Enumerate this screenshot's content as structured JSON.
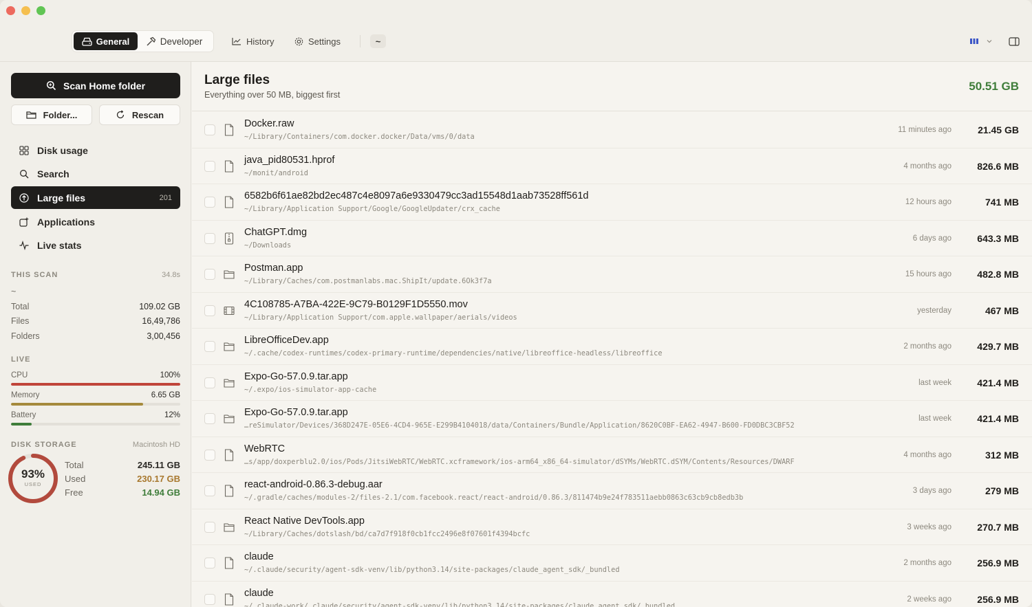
{
  "toolbar": {
    "tabs": [
      {
        "label": "General",
        "active": true,
        "icon": "drive-icon"
      },
      {
        "label": "Developer",
        "active": false,
        "icon": "hammer-icon"
      }
    ],
    "history_label": "History",
    "settings_label": "Settings",
    "tilde_label": "~"
  },
  "sidebar": {
    "scan_button": "Scan Home folder",
    "folder_button": "Folder...",
    "rescan_button": "Rescan",
    "nav": [
      {
        "label": "Disk usage",
        "icon": "grid-icon",
        "badge": ""
      },
      {
        "label": "Search",
        "icon": "search-icon",
        "badge": ""
      },
      {
        "label": "Large files",
        "icon": "arrow-up-circle-icon",
        "badge": "201",
        "active": true
      },
      {
        "label": "Applications",
        "icon": "app-add-icon",
        "badge": ""
      },
      {
        "label": "Live stats",
        "icon": "pulse-icon",
        "badge": ""
      }
    ],
    "this_scan": {
      "heading": "THIS SCAN",
      "duration": "34.8s",
      "path": "~",
      "stats": [
        {
          "label": "Total",
          "value": "109.02 GB"
        },
        {
          "label": "Files",
          "value": "16,49,786"
        },
        {
          "label": "Folders",
          "value": "3,00,456"
        }
      ]
    },
    "live": {
      "heading": "LIVE",
      "cpu": {
        "label": "CPU",
        "value": "100%",
        "fraction": 1.0,
        "color": "#c0453a"
      },
      "memory": {
        "label": "Memory",
        "value": "6.65 GB",
        "fraction": 0.78,
        "color": "#a58a3c"
      },
      "battery": {
        "label": "Battery",
        "value": "12%",
        "fraction": 0.12,
        "color": "#3f7d3a"
      }
    },
    "disk": {
      "heading": "DISK STORAGE",
      "volume": "Macintosh HD",
      "percent": "93%",
      "used_caption": "USED",
      "fraction_used": 0.93,
      "ring_color": "#b24a3d",
      "total_label": "Total",
      "total": "245.11 GB",
      "used_label": "Used",
      "used": "230.17 GB",
      "used_color": "#a8782e",
      "free_label": "Free",
      "free": "14.94 GB",
      "free_color": "#3f7d3a"
    }
  },
  "main": {
    "title": "Large files",
    "subtitle": "Everything over 50 MB, biggest first",
    "total": "50.51 GB",
    "rows": [
      {
        "name": "Docker.raw",
        "path": "~/Library/Containers/com.docker.docker/Data/vms/0/data",
        "when": "11 minutes ago",
        "size": "21.45 GB",
        "icon": "file-icon"
      },
      {
        "name": "java_pid80531.hprof",
        "path": "~/monit/android",
        "when": "4 months ago",
        "size": "826.6 MB",
        "icon": "file-icon"
      },
      {
        "name": "6582b6f61ae82bd2ec487c4e8097a6e9330479cc3ad15548d1aab73528ff561d",
        "path": "~/Library/Application Support/Google/GoogleUpdater/crx_cache",
        "when": "12 hours ago",
        "size": "741 MB",
        "icon": "file-icon"
      },
      {
        "name": "ChatGPT.dmg",
        "path": "~/Downloads",
        "when": "6 days ago",
        "size": "643.3 MB",
        "icon": "archive-icon"
      },
      {
        "name": "Postman.app",
        "path": "~/Library/Caches/com.postmanlabs.mac.ShipIt/update.6Ok3f7a",
        "when": "15 hours ago",
        "size": "482.8 MB",
        "icon": "folder-icon"
      },
      {
        "name": "4C108785-A7BA-422E-9C79-B0129F1D5550.mov",
        "path": "~/Library/Application Support/com.apple.wallpaper/aerials/videos",
        "when": "yesterday",
        "size": "467 MB",
        "icon": "film-icon"
      },
      {
        "name": "LibreOfficeDev.app",
        "path": "~/.cache/codex-runtimes/codex-primary-runtime/dependencies/native/libreoffice-headless/libreoffice",
        "when": "2 months ago",
        "size": "429.7 MB",
        "icon": "folder-icon"
      },
      {
        "name": "Expo-Go-57.0.9.tar.app",
        "path": "~/.expo/ios-simulator-app-cache",
        "when": "last week",
        "size": "421.4 MB",
        "icon": "folder-icon"
      },
      {
        "name": "Expo-Go-57.0.9.tar.app",
        "path": "…reSimulator/Devices/368D247E-05E6-4CD4-965E-E299B4104018/data/Containers/Bundle/Application/8620C0BF-EA62-4947-B600-FD0DBC3CBF52",
        "when": "last week",
        "size": "421.4 MB",
        "icon": "folder-icon"
      },
      {
        "name": "WebRTC",
        "path": "…s/app/doxperblu2.0/ios/Pods/JitsiWebRTC/WebRTC.xcframework/ios-arm64_x86_64-simulator/dSYMs/WebRTC.dSYM/Contents/Resources/DWARF",
        "when": "4 months ago",
        "size": "312 MB",
        "icon": "file-icon"
      },
      {
        "name": "react-android-0.86.3-debug.aar",
        "path": "~/.gradle/caches/modules-2/files-2.1/com.facebook.react/react-android/0.86.3/811474b9e24f783511aebb0863c63cb9cb8edb3b",
        "when": "3 days ago",
        "size": "279 MB",
        "icon": "file-icon"
      },
      {
        "name": "React Native DevTools.app",
        "path": "~/Library/Caches/dotslash/bd/ca7d7f918f0cb1fcc2496e8f07601f4394bcfc",
        "when": "3 weeks ago",
        "size": "270.7 MB",
        "icon": "folder-icon"
      },
      {
        "name": "claude",
        "path": "~/.claude/security/agent-sdk-venv/lib/python3.14/site-packages/claude_agent_sdk/_bundled",
        "when": "2 months ago",
        "size": "256.9 MB",
        "icon": "file-icon"
      },
      {
        "name": "claude",
        "path": "~/.claude-work/.claude/security/agent-sdk-venv/lib/python3.14/site-packages/claude_agent_sdk/_bundled",
        "when": "2 weeks ago",
        "size": "256.9 MB",
        "icon": "file-icon"
      }
    ]
  }
}
